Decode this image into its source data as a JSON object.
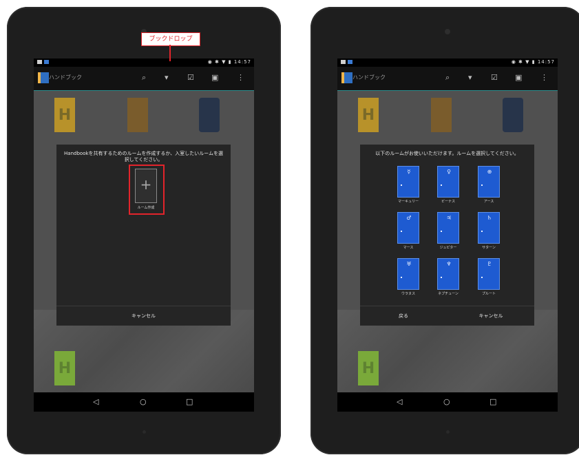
{
  "callout": {
    "label": "ブックドロップ"
  },
  "device": {
    "status_time": "14:57",
    "app_title": "ハンドブック",
    "action_icons": [
      "search-icon",
      "book-drop-icon",
      "checkbox-icon",
      "rooms-icon",
      "overflow-menu-icon"
    ],
    "nav_icons": [
      "back-icon",
      "home-icon",
      "recents-icon"
    ]
  },
  "left": {
    "dialog": {
      "message": "Handbookを共有するためのルームを作成するか、入室したいルームを選択してください。",
      "create_label": "ルーム作成",
      "cancel": "キャンセル"
    }
  },
  "right": {
    "dialog": {
      "message": "以下のルームがお使いいただけます。ルームを選択してください。",
      "rooms": [
        {
          "name": "マーキュリー",
          "symbol": "☿"
        },
        {
          "name": "ビーナス",
          "symbol": "♀"
        },
        {
          "name": "アース",
          "symbol": "⊕"
        },
        {
          "name": "マース",
          "symbol": "♂"
        },
        {
          "name": "ジュピター",
          "symbol": "♃"
        },
        {
          "name": "サターン",
          "symbol": "♄"
        },
        {
          "name": "ウラヌス",
          "symbol": "♅"
        },
        {
          "name": "ネプチューン",
          "symbol": "♆"
        },
        {
          "name": "プルート",
          "symbol": "♇"
        }
      ],
      "back": "戻る",
      "cancel": "キャンセル"
    }
  },
  "colors": {
    "accent": "#e3242b",
    "door": "#1e5bd1",
    "appbar_line": "#2a8a8a"
  }
}
